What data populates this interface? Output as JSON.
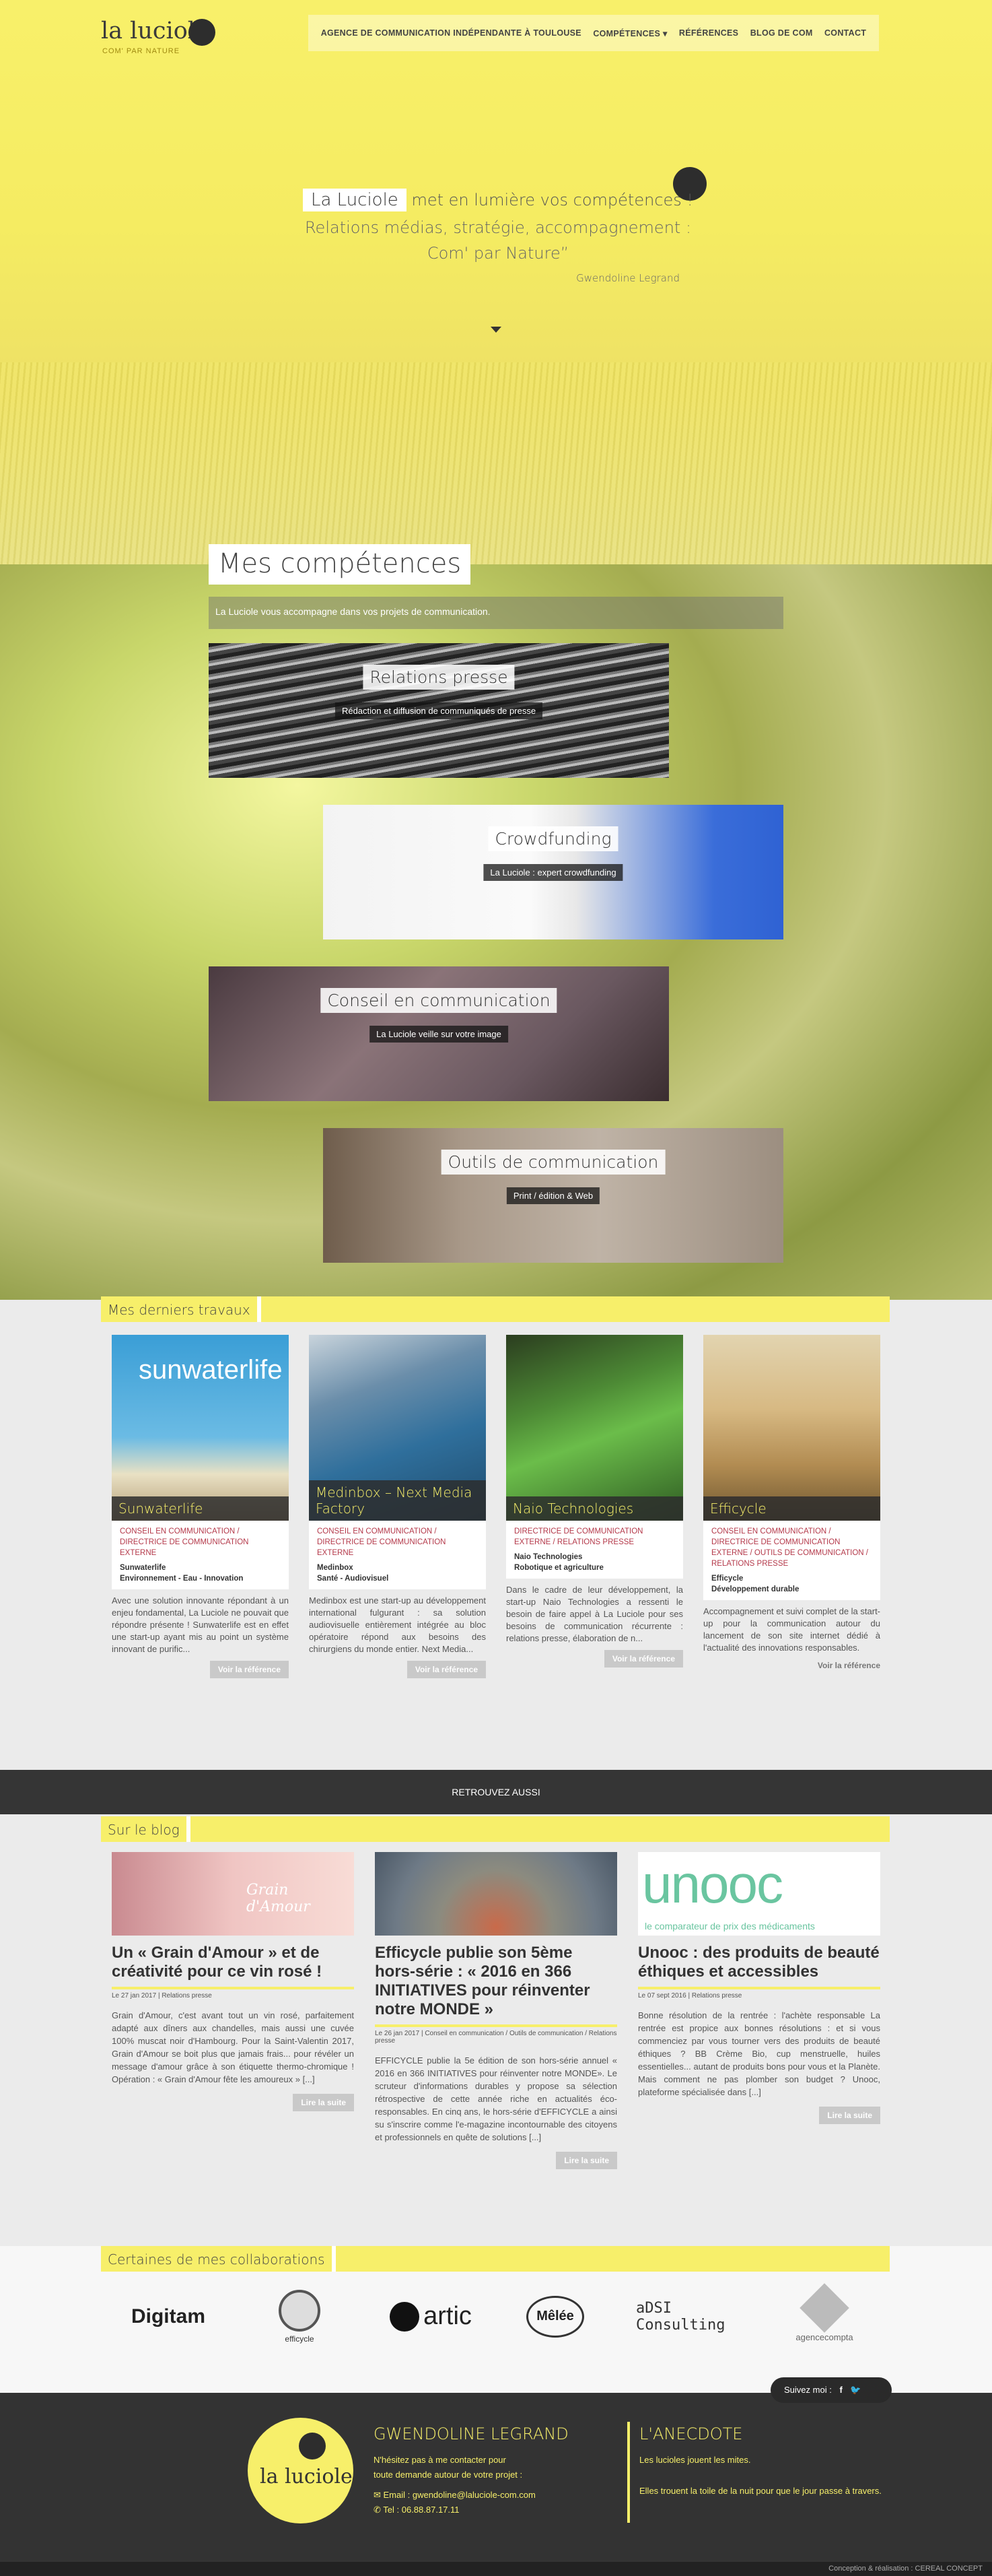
{
  "brand": {
    "name": "la luciole",
    "tagline": "COM' PAR NATURE"
  },
  "nav": {
    "items": [
      "AGENCE DE COMMUNICATION INDÉPENDANTE À TOULOUSE",
      "COMPÉTENCES ▾",
      "RÉFÉRENCES",
      "BLOG DE COM",
      "CONTACT"
    ]
  },
  "hero": {
    "brand": "La Luciole",
    "line1": "met en lumière vos compétences !",
    "line2": "Relations médias, stratégie, accompagnement :",
    "line3": "Com' par Nature",
    "author": "Gwendoline Legrand"
  },
  "competences": {
    "title": "Mes compétences",
    "subtitle": "La Luciole vous accompagne dans vos projets de communication.",
    "cards": [
      {
        "title": "Relations presse",
        "subtitle": "Rédaction et diffusion de communiqués de presse"
      },
      {
        "title": "Crowdfunding",
        "subtitle": "La Luciole : expert crowdfunding"
      },
      {
        "title": "Conseil en communication",
        "subtitle": "La Luciole veille sur votre image"
      },
      {
        "title": "Outils de communication",
        "subtitle": "Print / édition & Web"
      }
    ]
  },
  "travaux": {
    "label": "Mes derniers travaux",
    "button": "Voir la référence",
    "items": [
      {
        "title": "Sunwaterlife",
        "cat": "CONSEIL EN COMMUNICATION / DIRECTRICE DE COMMUNICATION EXTERNE",
        "client": "Sunwaterlife",
        "sector": "Environnement - Eau - Innovation",
        "desc": "Avec une solution innovante répondant à un enjeu fondamental, La Luciole ne pouvait que répondre présente ! Sunwaterlife est en effet une start-up ayant mis au point un système innovant de purific...",
        "thumb_text": "sunwaterlife"
      },
      {
        "title": "Medinbox – Next Media Factory",
        "cat": "CONSEIL EN COMMUNICATION / DIRECTRICE DE COMMUNICATION EXTERNE",
        "client": "Medinbox",
        "sector": "Santé - Audiovisuel",
        "desc": "Medinbox est une start-up au développement international fulgurant : sa solution audiovisuelle entièrement intégrée au bloc opératoire répond aux besoins des chirurgiens du monde entier. Next Media..."
      },
      {
        "title": "Naio Technologies",
        "cat": "DIRECTRICE DE COMMUNICATION EXTERNE / RELATIONS PRESSE",
        "client": "Naio Technologies",
        "sector": "Robotique et agriculture",
        "desc": "Dans le cadre de leur développement, la start-up Naio Technologies a ressenti le besoin de faire appel à La Luciole pour ses besoins de communication récurrente : relations presse, élaboration de n..."
      },
      {
        "title": "Efficycle",
        "cat": "CONSEIL EN COMMUNICATION / DIRECTRICE DE COMMUNICATION EXTERNE / OUTILS DE COMMUNICATION / RELATIONS PRESSE",
        "client": "Efficycle",
        "sector": "Développement durable",
        "desc": "Accompagnement et suivi complet de la start-up pour la communication autour du lancement de son site internet dédié à l'actualité des innovations responsables."
      }
    ]
  },
  "retrouvez": "RETROUVEZ AUSSI",
  "blog": {
    "label": "Sur le blog",
    "button": "Lire la suite",
    "posts": [
      {
        "title": "Un « Grain d'Amour » et de créativité pour ce vin rosé !",
        "meta": "Le 27 jan 2017 | Relations presse",
        "desc": "Grain d'Amour, c'est avant tout un vin rosé, parfaitement adapté aux dîners aux chandelles, mais aussi une cuvée 100% muscat noir d'Hambourg. Pour la Saint-Valentin 2017, Grain d'Amour se boit plus que jamais frais... pour révéler un message d'amour grâce à son étiquette thermo-chromique ! Opération : « Grain d'Amour fête les amoureux » [...]",
        "img_text": "Grain d'Amour"
      },
      {
        "title": "Efficycle publie son 5ème hors-série : « 2016 en 366 INITIATIVES pour réinventer notre MONDE »",
        "meta": "Le 26 jan 2017 | Conseil en communication / Outils de communication / Relations presse",
        "desc": "EFFICYCLE publie la 5e édition de son hors-série annuel « 2016 en 366 INITIATIVES pour réinventer notre MONDE». Le scruteur d'informations durables y propose sa sélection rétrospective de cette année riche en actualités éco-responsables. En cinq ans, le hors-série d'EFFICYCLE a ainsi su s'inscrire comme l'e-magazine incontournable des citoyens et professionnels en quête de solutions [...]"
      },
      {
        "title": "Unooc : des produits de beauté éthiques et accessibles",
        "meta": "Le 07 sept 2016 | Relations presse",
        "desc": "Bonne résolution de la rentrée : l'achète responsable La rentrée est propice aux bonnes résolutions : et si vous commenciez par vous tourner vers des produits de beauté éthiques ? BB Crème Bio, cup menstruelle, huiles essentielles... autant de produits bons pour vous et la Planète. Mais comment ne pas plomber son budget ? Unooc, plateforme spécialisée dans [...]",
        "img_text": "unooc",
        "img_sub": "le comparateur de prix des médicaments"
      }
    ]
  },
  "collab": {
    "label": "Certaines de mes collaborations",
    "logos": [
      "Digitam",
      "efficycle",
      "artic",
      "Mêlée",
      "aDSI Consulting",
      "agencecompta"
    ]
  },
  "footer": {
    "follow": "Suivez moi :",
    "name": "GWENDOLINE LEGRAND",
    "intro1": "N'hésitez pas à me contacter pour",
    "intro2": "toute demande autour de votre projet :",
    "email": "Email : gwendoline@laluciole-com.com",
    "tel": "Tel : 06.88.87.17.11",
    "anec_title": "L'ANECDOTE",
    "anec1": "Les lucioles jouent les mites.",
    "anec2": "Elles trouent la toile de la nuit pour que le jour passe à travers.",
    "credit": "Conception & réalisation : CEREAL CONCEPT"
  }
}
